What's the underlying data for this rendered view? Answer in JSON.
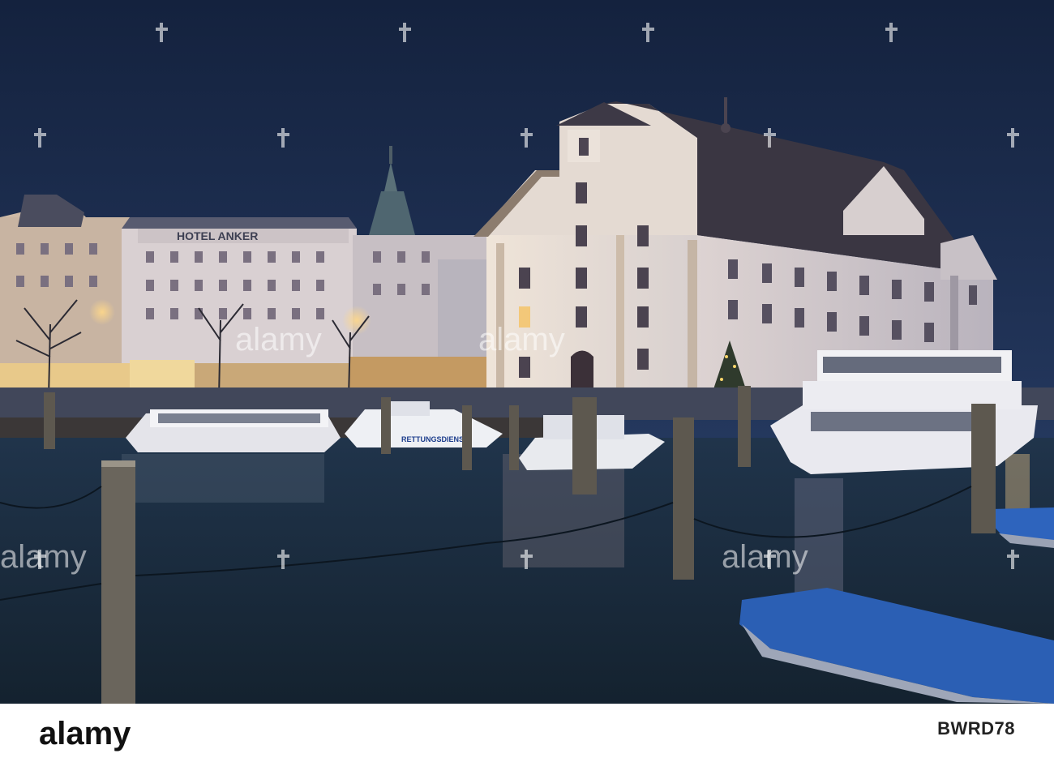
{
  "photo": {
    "sign_text": "HOTEL ANKER",
    "boat_text": "RETTUNGSDIENST",
    "colors": {
      "sky_top": "#14223e",
      "sky_bottom": "#2a3f67",
      "water": "#1a2b3f",
      "facade_lit": "#e9e1dc",
      "cover_blue": "#2b5fb4"
    }
  },
  "watermark": {
    "word": "alamy",
    "icon": "cross-icon"
  },
  "footer": {
    "logo_text": "alamy",
    "image_id": "BWRD78"
  }
}
